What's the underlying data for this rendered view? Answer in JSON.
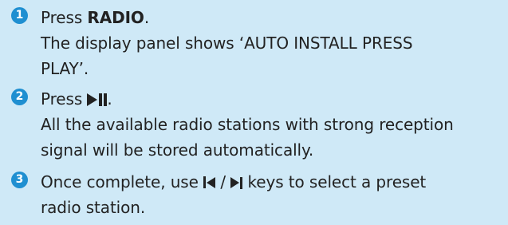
{
  "steps": [
    {
      "number": "1",
      "action_prefix": "Press ",
      "action_bold": "RADIO",
      "action_suffix": ".",
      "result_lines": [
        "The display panel shows ‘AUTO INSTALL PRESS",
        "PLAY’."
      ]
    },
    {
      "number": "2",
      "action_prefix": "Press ",
      "action_icon": "play-pause-icon",
      "action_suffix": ".",
      "result_lines": [
        "All the available radio stations with strong reception",
        "signal will be stored automatically."
      ]
    },
    {
      "number": "3",
      "line1_prefix": "Once complete, use ",
      "icon_left": "previous-icon",
      "separator": " / ",
      "icon_right": "next-icon",
      "line1_suffix": " keys to select a preset",
      "line2": "radio station."
    }
  ],
  "colors": {
    "background": "#cfe9f7",
    "number_circle": "#1f8fd1",
    "text": "#222222"
  }
}
